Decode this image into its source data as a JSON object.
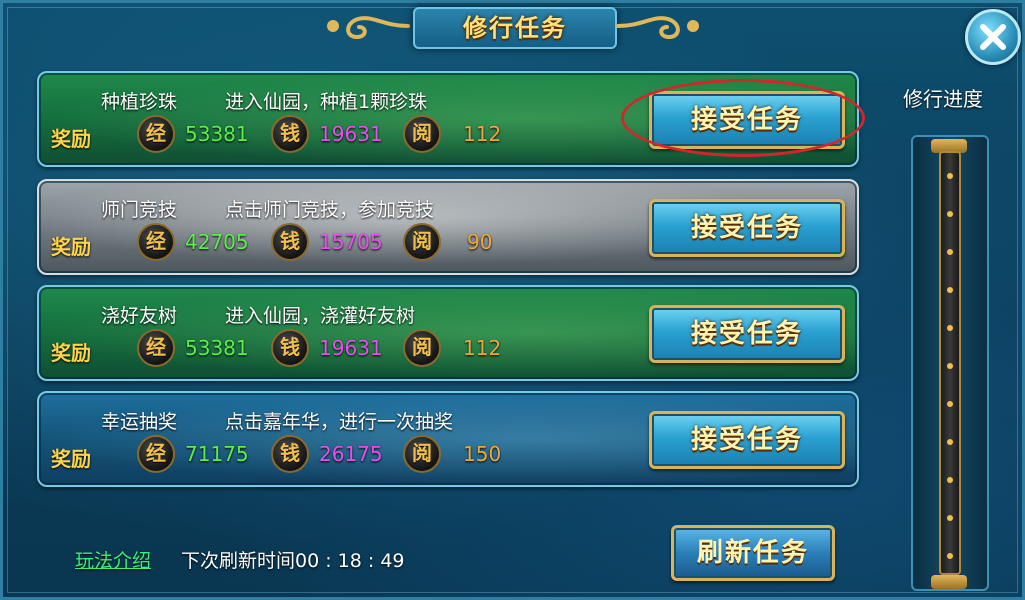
{
  "window": {
    "title": "修行任务"
  },
  "tasks": [
    {
      "name": "种植珍珠",
      "description": "进入仙园，种植1颗珍珠",
      "reward_label": "奖励",
      "rewards": [
        {
          "icon": "经",
          "value": "53381"
        },
        {
          "icon": "钱",
          "value": "19631"
        },
        {
          "icon": "阅",
          "value": "112"
        }
      ],
      "button": "接受任务",
      "style": "green",
      "highlighted": true
    },
    {
      "name": "师门竞技",
      "description": "点击师门竞技，参加竞技",
      "reward_label": "奖励",
      "rewards": [
        {
          "icon": "经",
          "value": "42705"
        },
        {
          "icon": "钱",
          "value": "15705"
        },
        {
          "icon": "阅",
          "value": "90"
        }
      ],
      "button": "接受任务",
      "style": "grey",
      "highlighted": false
    },
    {
      "name": "浇好友树",
      "description": "进入仙园，浇灌好友树",
      "reward_label": "奖励",
      "rewards": [
        {
          "icon": "经",
          "value": "53381"
        },
        {
          "icon": "钱",
          "value": "19631"
        },
        {
          "icon": "阅",
          "value": "112"
        }
      ],
      "button": "接受任务",
      "style": "green",
      "highlighted": false
    },
    {
      "name": "幸运抽奖",
      "description": "点击嘉年华，进行一次抽奖",
      "reward_label": "奖励",
      "rewards": [
        {
          "icon": "经",
          "value": "71175"
        },
        {
          "icon": "钱",
          "value": "26175"
        },
        {
          "icon": "阅",
          "value": "150"
        }
      ],
      "button": "接受任务",
      "style": "blue",
      "highlighted": false
    }
  ],
  "progress": {
    "title": "修行进度",
    "fraction": 0.0
  },
  "footer": {
    "how_to_label": "玩法介绍",
    "refresh_time_text": "下次刷新时间00 : 18 : 49",
    "refresh_button": "刷新任务"
  },
  "colors": {
    "exp": "#5af04a",
    "money": "#e94ef0",
    "read": "#f0a63a",
    "button_text": "#fff3b0",
    "highlight": "#d0272b"
  },
  "icons": {
    "close": "close-icon",
    "exp": "exp-coin-icon",
    "money": "money-coin-icon",
    "read": "read-coin-icon"
  }
}
